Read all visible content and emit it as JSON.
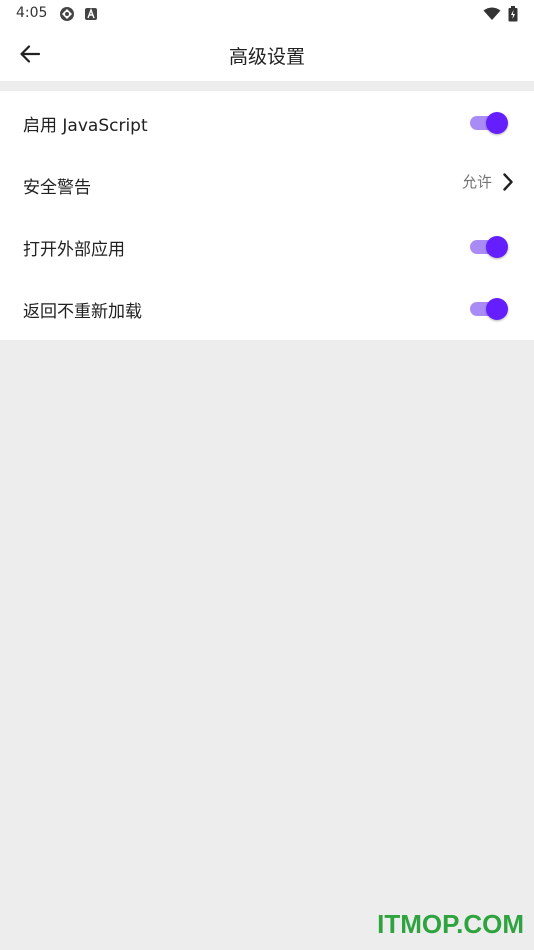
{
  "status_bar": {
    "time": "4:05",
    "icons": [
      "sync-icon",
      "keyboard-a-icon",
      "wifi-icon",
      "battery-icon"
    ]
  },
  "app_bar": {
    "title": "高级设置",
    "back_icon": "arrow-back-icon"
  },
  "settings": {
    "items": [
      {
        "label": "启用 JavaScript",
        "type": "toggle",
        "checked": true
      },
      {
        "label": "安全警告",
        "type": "value",
        "value": "允许"
      },
      {
        "label": "打开外部应用",
        "type": "toggle",
        "checked": true
      },
      {
        "label": "返回不重新加载",
        "type": "toggle",
        "checked": true
      }
    ]
  },
  "colors": {
    "accent": "#651fff",
    "accent_track": "#a98bf6",
    "background": "#ededed",
    "surface": "#ffffff"
  },
  "watermark": "ITMOP.COM"
}
